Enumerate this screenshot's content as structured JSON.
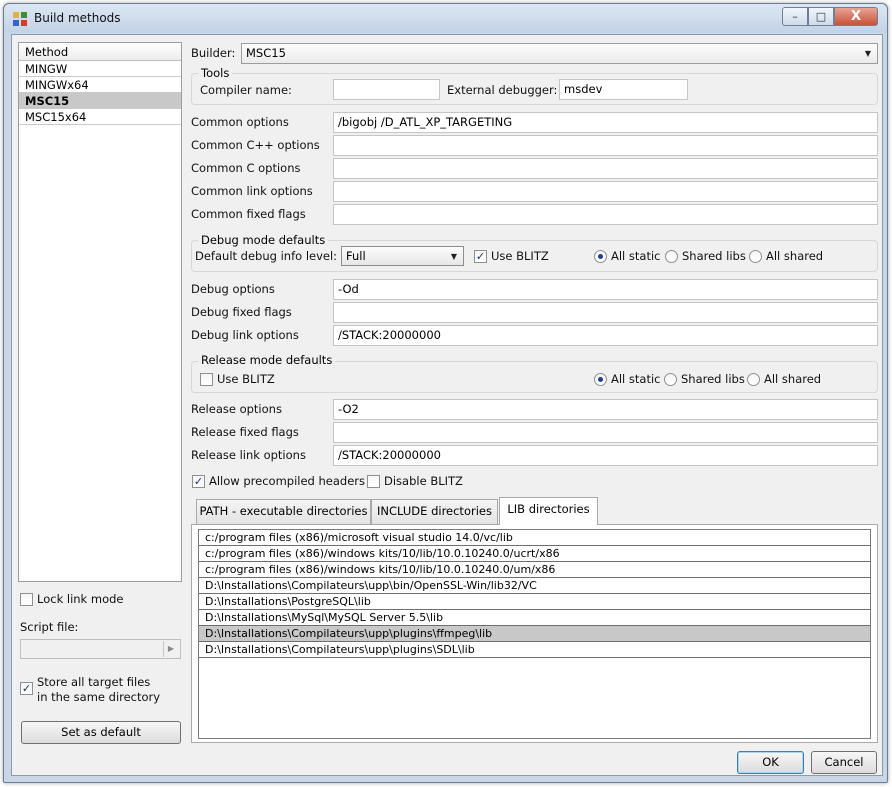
{
  "window": {
    "title": "Build methods"
  },
  "methods": {
    "header": "Method",
    "items": [
      "MINGW",
      "MINGWx64",
      "MSC15",
      "MSC15x64"
    ],
    "selected": "MSC15"
  },
  "left": {
    "lock_link_mode": "Lock link mode",
    "script_file_label": "Script file:",
    "store_all_line1": "Store all target files",
    "store_all_line2": "in the same directory",
    "set_default": "Set as default"
  },
  "builder": {
    "label": "Builder:",
    "value": "MSC15"
  },
  "tools": {
    "title": "Tools",
    "compiler_label": "Compiler name:",
    "compiler_value": "",
    "debugger_label": "External debugger:",
    "debugger_value": "msdev"
  },
  "options": {
    "common_options_label": "Common options",
    "common_options_value": "/bigobj /D_ATL_XP_TARGETING",
    "common_cpp_label": "Common C++ options",
    "common_cpp_value": "",
    "common_c_label": "Common C options",
    "common_c_value": "",
    "common_link_label": "Common link options",
    "common_link_value": "",
    "common_fixed_label": "Common fixed flags",
    "common_fixed_value": ""
  },
  "debug": {
    "title": "Debug mode defaults",
    "info_level_label": "Default debug info level:",
    "info_level_value": "Full",
    "use_blitz": "Use BLITZ",
    "all_static": "All static",
    "shared_libs": "Shared libs",
    "all_shared": "All shared",
    "options_label": "Debug options",
    "options_value": "-Od",
    "fixed_label": "Debug fixed flags",
    "fixed_value": "",
    "link_label": "Debug link options",
    "link_value": "/STACK:20000000"
  },
  "release": {
    "title": "Release mode defaults",
    "use_blitz": "Use BLITZ",
    "all_static": "All static",
    "shared_libs": "Shared libs",
    "all_shared": "All shared",
    "options_label": "Release options",
    "options_value": "-O2",
    "fixed_label": "Release fixed flags",
    "fixed_value": "",
    "link_label": "Release link options",
    "link_value": "/STACK:20000000"
  },
  "flags": {
    "precompiled": "Allow precompiled headers",
    "disable_blitz": "Disable BLITZ"
  },
  "tabs": [
    "PATH - executable directories",
    "INCLUDE directories",
    "LIB directories"
  ],
  "lib_dirs": [
    "c:/program files (x86)/microsoft visual studio 14.0/vc/lib",
    "c:/program files (x86)/windows kits/10/lib/10.0.10240.0/ucrt/x86",
    "c:/program files (x86)/windows kits/10/lib/10.0.10240.0/um/x86",
    "D:\\Installations\\Compilateurs\\upp\\bin/OpenSSL-Win/lib32/VC",
    "D:\\Installations\\PostgreSQL\\lib",
    "D:\\Installations\\MySql\\MySQL Server 5.5\\lib",
    "D:\\Installations\\Compilateurs\\upp\\plugins\\ffmpeg\\lib",
    "D:\\Installations\\Compilateurs\\upp\\plugins\\SDL\\lib"
  ],
  "buttons": {
    "ok": "OK",
    "cancel": "Cancel"
  },
  "window_buttons": {
    "minimize": "–",
    "maximize": "□",
    "close": "X"
  },
  "colors": {
    "titlebar": "#c9d6e6",
    "selection": "#c8c8c8",
    "close": "#c9513a"
  }
}
